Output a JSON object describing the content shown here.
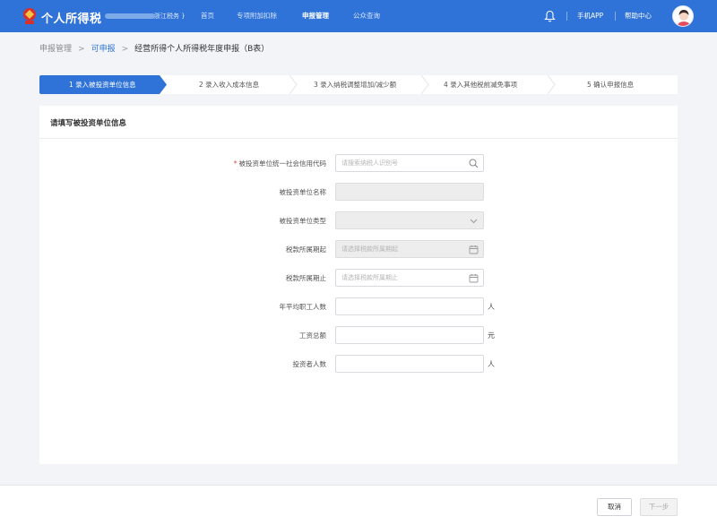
{
  "header": {
    "title": "个人所得税",
    "region": "浙江税务 }",
    "nav": [
      {
        "label": "首页",
        "active": false
      },
      {
        "label": "专项附加扣除",
        "active": false
      },
      {
        "label": "申报管理",
        "active": true
      },
      {
        "label": "公众查询",
        "active": false
      }
    ],
    "app_link": "手机APP",
    "help_link": "帮助中心",
    "brand_color": "#2f73d8"
  },
  "breadcrumb": {
    "items": [
      "申报管理",
      "可申报",
      "经营所得个人所得税年度申报（B表）"
    ]
  },
  "steps": [
    "1 录入被投资单位信息",
    "2 录入收入成本信息",
    "3 录入纳税调整增加/减少额",
    "4 录入其他税前减免事项",
    "5 确认申报信息"
  ],
  "form": {
    "title": "请填写被投资单位信息",
    "fields": [
      {
        "label": "被投资单位统一社会信用代码",
        "required": true,
        "placeholder": "请搜索纳税人识别号",
        "icon": "search-icon"
      },
      {
        "label": "被投资单位名称",
        "required": false,
        "placeholder": "",
        "disabled": true
      },
      {
        "label": "被投资单位类型",
        "required": false,
        "placeholder": "",
        "disabled": true,
        "icon": "chevron-down-icon"
      },
      {
        "label": "税款所属期起",
        "required": false,
        "placeholder": "请选择税款所属期起",
        "disabled": true,
        "icon": "calendar-icon"
      },
      {
        "label": "税款所属期止",
        "required": false,
        "placeholder": "请选择税款所属期止",
        "icon": "calendar-icon"
      },
      {
        "label": "年平均职工人数",
        "required": false,
        "placeholder": "",
        "unit": "人"
      },
      {
        "label": "工资总额",
        "required": false,
        "placeholder": "",
        "unit": "元"
      },
      {
        "label": "投资者人数",
        "required": false,
        "placeholder": "",
        "unit": "人"
      }
    ]
  },
  "footer": {
    "cancel": "取消",
    "next": "下一步"
  }
}
